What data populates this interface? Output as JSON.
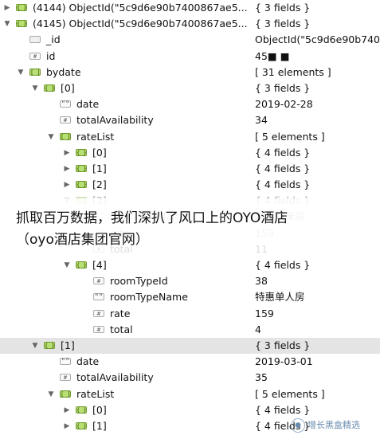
{
  "rows": [
    {
      "depth": 0,
      "arrow": "right",
      "icon": "obj",
      "key": "(4144) ObjectId(\"5c9d6e90b7400867ae5...",
      "value": "{ 3 fields }"
    },
    {
      "depth": 0,
      "arrow": "down",
      "icon": "obj",
      "key": "(4145) ObjectId(\"5c9d6e90b7400867ae5...",
      "value": "{ 3 fields }"
    },
    {
      "depth": 1,
      "arrow": "",
      "icon": "oid",
      "key": "_id",
      "value": "ObjectId(\"5c9d6e90b740"
    },
    {
      "depth": 1,
      "arrow": "",
      "icon": "num",
      "key": "id",
      "value": "45■ ■"
    },
    {
      "depth": 1,
      "arrow": "down",
      "icon": "arr",
      "key": "bydate",
      "value": "[ 31 elements ]"
    },
    {
      "depth": 2,
      "arrow": "down",
      "icon": "obj",
      "key": "[0]",
      "value": "{ 3 fields }"
    },
    {
      "depth": 3,
      "arrow": "",
      "icon": "str",
      "key": "date",
      "value": "2019-02-28"
    },
    {
      "depth": 3,
      "arrow": "",
      "icon": "num",
      "key": "totalAvailability",
      "value": "34"
    },
    {
      "depth": 3,
      "arrow": "down",
      "icon": "arr",
      "key": "rateList",
      "value": "[ 5 elements ]"
    },
    {
      "depth": 4,
      "arrow": "right",
      "icon": "obj",
      "key": "[0]",
      "value": "{ 4 fields }"
    },
    {
      "depth": 4,
      "arrow": "right",
      "icon": "obj",
      "key": "[1]",
      "value": "{ 4 fields }"
    },
    {
      "depth": 4,
      "arrow": "right",
      "icon": "obj",
      "key": "[2]",
      "value": "{ 4 fields }"
    },
    {
      "depth": 4,
      "arrow": "down",
      "icon": "obj",
      "key": "[3]",
      "value": "{ 4 fields }",
      "faded": true
    },
    {
      "depth": 5,
      "arrow": "",
      "icon": "str",
      "key": "roomTypeName",
      "value": "豪华双床房",
      "faded": true
    },
    {
      "depth": 5,
      "arrow": "",
      "icon": "num",
      "key": "rate",
      "value": "159",
      "faded": true
    },
    {
      "depth": 5,
      "arrow": "",
      "icon": "num",
      "key": "total",
      "value": "11"
    },
    {
      "depth": 4,
      "arrow": "down",
      "icon": "obj",
      "key": "[4]",
      "value": "{ 4 fields }"
    },
    {
      "depth": 5,
      "arrow": "",
      "icon": "num",
      "key": "roomTypeId",
      "value": "38"
    },
    {
      "depth": 5,
      "arrow": "",
      "icon": "str",
      "key": "roomTypeName",
      "value": "特惠单人房"
    },
    {
      "depth": 5,
      "arrow": "",
      "icon": "num",
      "key": "rate",
      "value": "159"
    },
    {
      "depth": 5,
      "arrow": "",
      "icon": "num",
      "key": "total",
      "value": "4"
    },
    {
      "depth": 2,
      "arrow": "down",
      "icon": "obj",
      "key": "[1]",
      "value": "{ 3 fields }",
      "selected": true
    },
    {
      "depth": 3,
      "arrow": "",
      "icon": "str",
      "key": "date",
      "value": "2019-03-01"
    },
    {
      "depth": 3,
      "arrow": "",
      "icon": "num",
      "key": "totalAvailability",
      "value": "35"
    },
    {
      "depth": 3,
      "arrow": "down",
      "icon": "arr",
      "key": "rateList",
      "value": "[ 5 elements ]"
    },
    {
      "depth": 4,
      "arrow": "right",
      "icon": "obj",
      "key": "[0]",
      "value": "{ 4 fields }"
    },
    {
      "depth": 4,
      "arrow": "right",
      "icon": "obj",
      "key": "[1]",
      "value": "{ 4 fields }"
    }
  ],
  "icon_glyphs": {
    "obj": "{ }",
    "arr": "[ ]",
    "str": "\"\"",
    "num": "#",
    "oid": ""
  },
  "caption": {
    "line1": "抓取百万数据，我们深扒了风口上的OYO酒店",
    "line2": "（oyo酒店集团官网）"
  },
  "watermark": {
    "text": "增长黑盒精选"
  }
}
